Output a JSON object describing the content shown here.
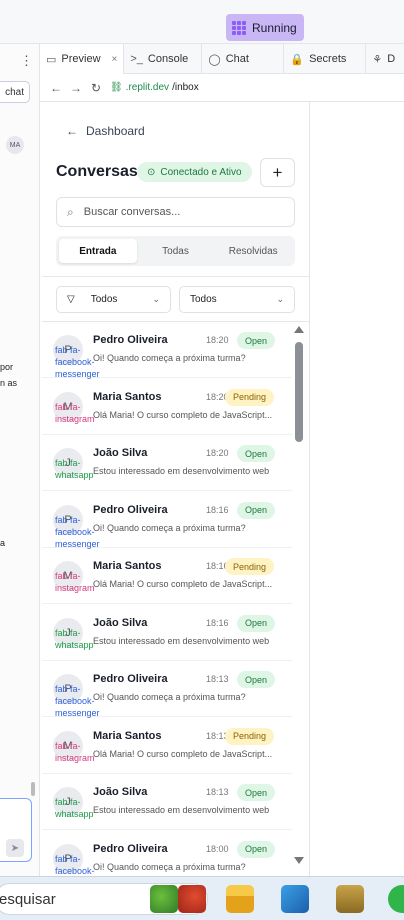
{
  "topbar": {
    "run_label": "Running"
  },
  "left_pane": {
    "chat_button": "chat",
    "avatar": "MA",
    "snippets": [
      "por",
      "n as",
      "a"
    ],
    "send_icon": "send-icon"
  },
  "tabs": [
    {
      "icon": "▭",
      "label": "Preview",
      "close": "×"
    },
    {
      "icon": ">_",
      "label": "Console"
    },
    {
      "icon": "◯",
      "label": "Chat"
    },
    {
      "icon": "🔒",
      "label": "Secrets"
    },
    {
      "icon": "⚘",
      "label": "D"
    }
  ],
  "url": {
    "back": "←",
    "forward": "→",
    "reload": "↻",
    "domain": ".replit.dev",
    "path": "/inbox"
  },
  "app": {
    "back_label": "Dashboard",
    "title": "Conversas",
    "status": "Conectado e Ativo",
    "add": "+",
    "search_placeholder": "Buscar conversas...",
    "segments": [
      "Entrada",
      "Todas",
      "Resolvidas"
    ],
    "filter1": "Todos",
    "filter2": "Todos"
  },
  "conversations": [
    {
      "avatar": "P",
      "icon_text": "fab fa-facebook-messenger",
      "channel": "fb",
      "name": "Pedro Oliveira",
      "time": "18:20",
      "status": "Open",
      "message": "Oi! Quando começa a próxima turma?"
    },
    {
      "avatar": "M",
      "icon_text": "fab fa-instagram",
      "channel": "ig",
      "name": "Maria Santos",
      "time": "18:20",
      "status": "Pending",
      "message": "Olá Maria! O curso completo de JavaScript..."
    },
    {
      "avatar": "J",
      "icon_text": "fab fa-whatsapp",
      "channel": "wa",
      "name": "João Silva",
      "time": "18:20",
      "status": "Open",
      "message": "Estou interessado em desenvolvimento web"
    },
    {
      "avatar": "P",
      "icon_text": "fab fa-facebook-messenger",
      "channel": "fb",
      "name": "Pedro Oliveira",
      "time": "18:16",
      "status": "Open",
      "message": "Oi! Quando começa a próxima turma?"
    },
    {
      "avatar": "M",
      "icon_text": "fab fa-instagram",
      "channel": "ig",
      "name": "Maria Santos",
      "time": "18:16",
      "status": "Pending",
      "message": "Olá Maria! O curso completo de JavaScript..."
    },
    {
      "avatar": "J",
      "icon_text": "fab fa-whatsapp",
      "channel": "wa",
      "name": "João Silva",
      "time": "18:16",
      "status": "Open",
      "message": "Estou interessado em desenvolvimento web"
    },
    {
      "avatar": "P",
      "icon_text": "fab fa-facebook-messenger",
      "channel": "fb",
      "name": "Pedro Oliveira",
      "time": "18:13",
      "status": "Open",
      "message": "Oi! Quando começa a próxima turma?"
    },
    {
      "avatar": "M",
      "icon_text": "fab fa-instagram",
      "channel": "ig",
      "name": "Maria Santos",
      "time": "18:13",
      "status": "Pending",
      "message": "Olá Maria! O curso completo de JavaScript..."
    },
    {
      "avatar": "J",
      "icon_text": "fab fa-whatsapp",
      "channel": "wa",
      "name": "João Silva",
      "time": "18:13",
      "status": "Open",
      "message": "Estou interessado em desenvolvimento web"
    },
    {
      "avatar": "P",
      "icon_text": "fab fa-facebook-messenger",
      "channel": "fb",
      "name": "Pedro Oliveira",
      "time": "18:00",
      "status": "Open",
      "message": "Oi! Quando começa a próxima turma?"
    }
  ],
  "taskbar": {
    "search_label": "esquisar"
  }
}
